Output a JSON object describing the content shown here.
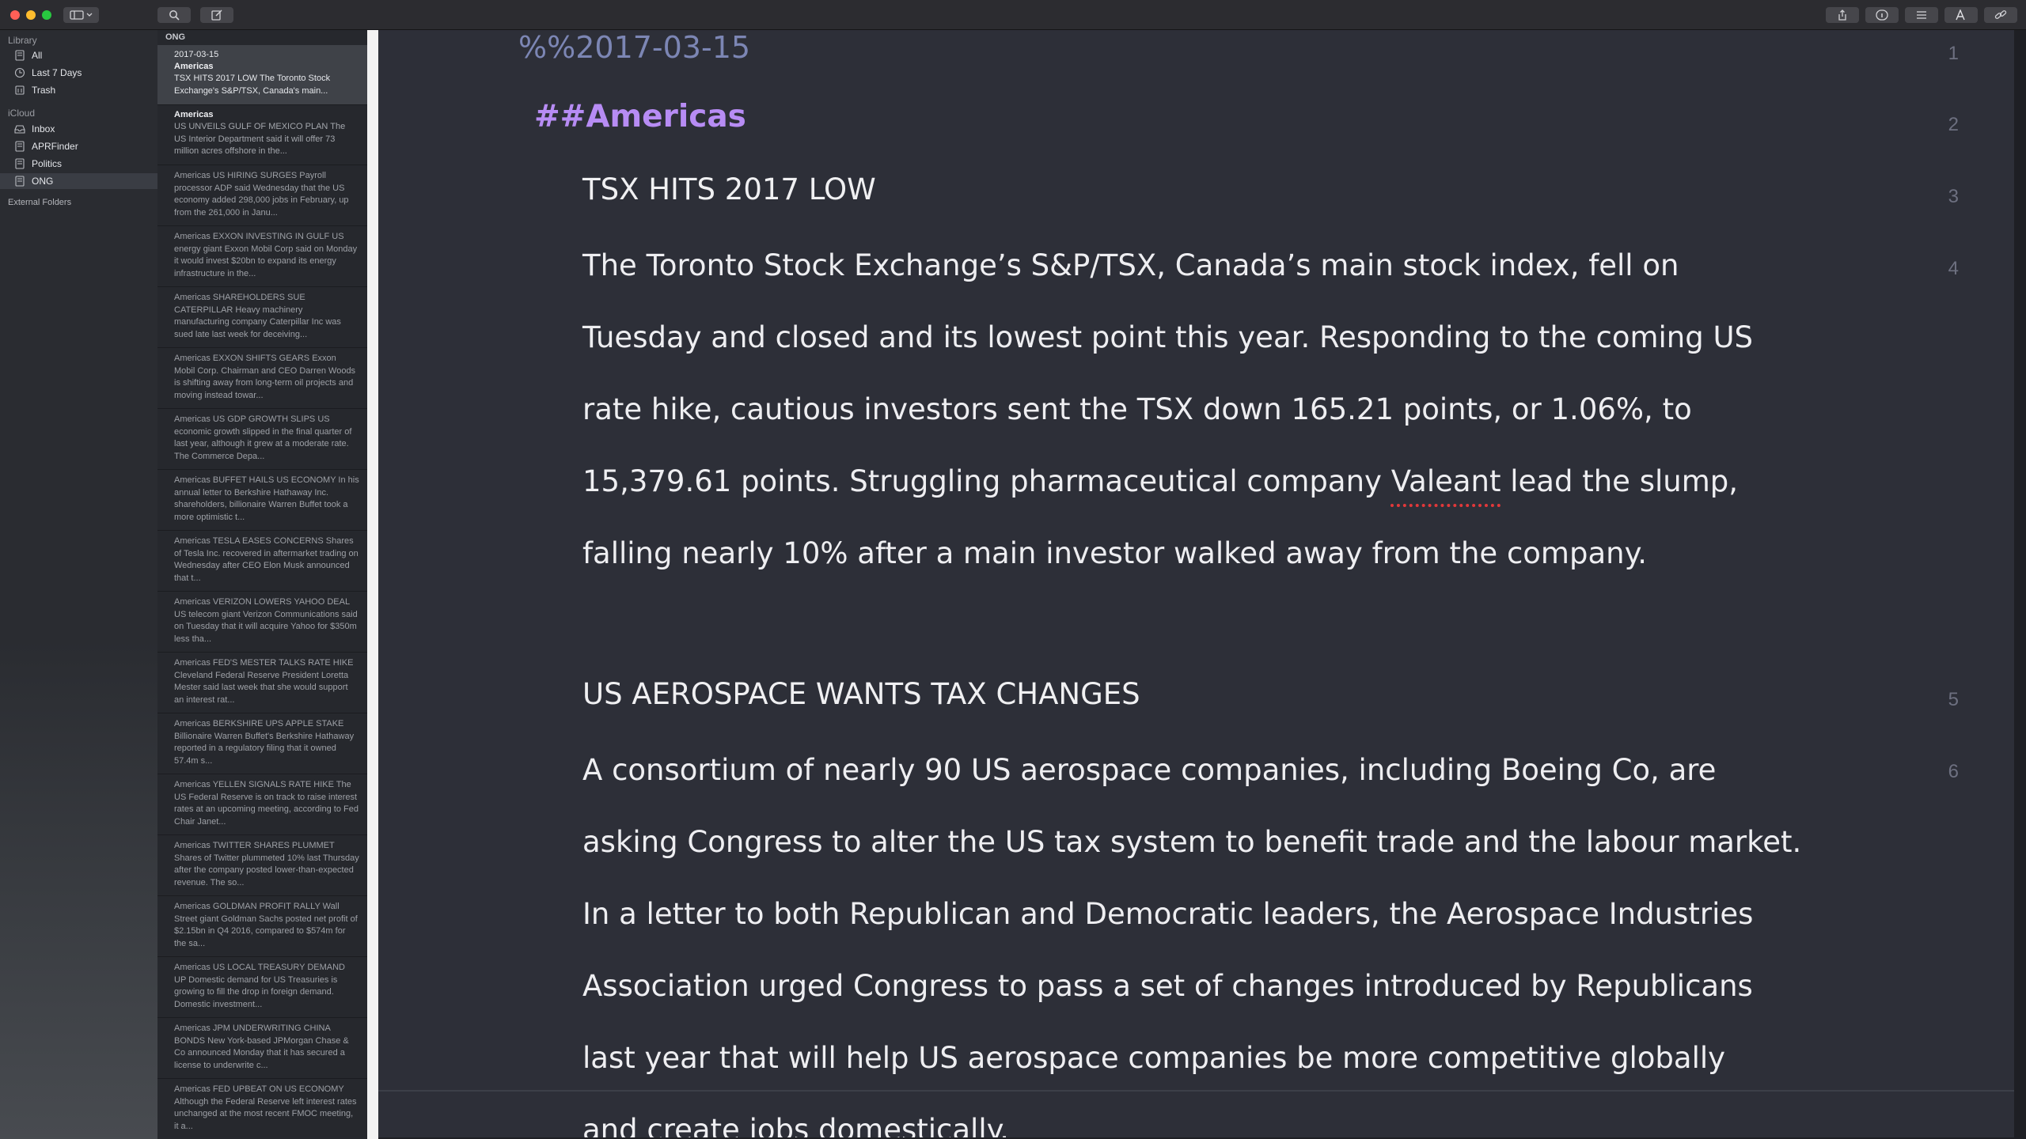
{
  "toolbar": {
    "icons": [
      "sidebar-toggle-icon",
      "search-icon",
      "compose-icon",
      "share-icon",
      "info-icon",
      "list-icon",
      "font-icon",
      "link-icon"
    ]
  },
  "sidebar": {
    "library_label": "Library",
    "library_items": [
      {
        "label": "All",
        "icon": "notes-icon"
      },
      {
        "label": "Last 7 Days",
        "icon": "clock-icon"
      },
      {
        "label": "Trash",
        "icon": "trash-icon"
      }
    ],
    "icloud_label": "iCloud",
    "icloud_items": [
      {
        "label": "Inbox",
        "icon": "inbox-icon"
      },
      {
        "label": "APRFinder",
        "icon": "folder-icon"
      },
      {
        "label": "Politics",
        "icon": "folder-icon"
      },
      {
        "label": "ONG",
        "icon": "folder-icon"
      }
    ],
    "external_label": "External Folders"
  },
  "notelist": {
    "header": "ONG",
    "notes": [
      {
        "date": "2017-03-15",
        "title": "Americas",
        "body": "TSX HITS 2017 LOW The Toronto Stock Exchange's S&P/TSX, Canada's main..."
      },
      {
        "date": "",
        "title": "Americas",
        "body": "US UNVEILS GULF OF MEXICO PLAN The US Interior Department said it will offer 73 million acres offshore in the..."
      },
      {
        "date": "",
        "title": "",
        "body": "Americas US HIRING SURGES Payroll processor ADP said Wednesday that the US economy added 298,000 jobs in February, up from the 261,000 in Janu..."
      },
      {
        "date": "",
        "title": "",
        "body": "Americas EXXON INVESTING IN GULF US energy giant Exxon Mobil Corp said on Monday it would invest $20bn to expand its energy infrastructure in the..."
      },
      {
        "date": "",
        "title": "",
        "body": "Americas SHAREHOLDERS SUE CATERPILLAR Heavy machinery manufacturing company Caterpillar Inc was sued late last week for deceiving..."
      },
      {
        "date": "",
        "title": "",
        "body": "Americas EXXON SHIFTS GEARS Exxon Mobil Corp. Chairman and CEO Darren Woods is shifting away from long-term oil projects and moving instead towar..."
      },
      {
        "date": "",
        "title": "",
        "body": "Americas US GDP GROWTH SLIPS US economic growth slipped in the final quarter of last year, although it grew at a moderate rate. The Commerce Depa..."
      },
      {
        "date": "",
        "title": "",
        "body": "Americas BUFFET HAILS US ECONOMY In his annual letter to Berkshire Hathaway Inc. shareholders, billionaire Warren Buffet took a more optimistic t..."
      },
      {
        "date": "",
        "title": "",
        "body": "Americas TESLA EASES CONCERNS Shares of Tesla Inc. recovered in aftermarket trading on Wednesday after CEO Elon Musk announced that t..."
      },
      {
        "date": "",
        "title": "",
        "body": "Americas VERIZON LOWERS YAHOO DEAL US telecom giant Verizon Communications said on Tuesday that it will acquire Yahoo for $350m less tha..."
      },
      {
        "date": "",
        "title": "",
        "body": "Americas FED'S MESTER TALKS RATE HIKE Cleveland Federal Reserve President Loretta Mester said last week that she would support an interest rat..."
      },
      {
        "date": "",
        "title": "",
        "body": "Americas BERKSHIRE UPS APPLE STAKE Billionaire Warren Buffet's Berkshire Hathaway reported in a regulatory filing that it owned 57.4m s..."
      },
      {
        "date": "",
        "title": "",
        "body": "Americas YELLEN SIGNALS RATE HIKE The US Federal Reserve is on track to raise interest rates at an upcoming meeting, according to Fed Chair Janet..."
      },
      {
        "date": "",
        "title": "",
        "body": "Americas TWITTER SHARES PLUMMET Shares of Twitter plummeted 10% last Thursday after the company posted lower-than-expected revenue. The so..."
      },
      {
        "date": "",
        "title": "",
        "body": "Americas GOLDMAN PROFIT RALLY Wall Street giant Goldman Sachs posted net profit of $2.15bn in Q4 2016, compared to $574m for the sa..."
      },
      {
        "date": "",
        "title": "",
        "body": "Americas US LOCAL TREASURY DEMAND UP Domestic demand for US Treasuries is growing to fill the drop in foreign demand. Domestic investment..."
      },
      {
        "date": "",
        "title": "",
        "body": "Americas JPM UNDERWRITING CHINA BONDS New York-based JPMorgan Chase & Co announced Monday that it has secured a license to underwrite c..."
      },
      {
        "date": "",
        "title": "",
        "body": "Americas FED UPBEAT ON US ECONOMY Although the Federal Reserve left interest rates unchanged at the most recent FMOC meeting, it a..."
      }
    ]
  },
  "editor": {
    "line1": "%%2017-03-15",
    "line2": "##Americas",
    "line3": "TSX HITS 2017 LOW",
    "para1": [
      "The Toronto Stock Exchange’s S&P/TSX, Canada’s main stock index, fell on",
      "Tuesday and closed and its lowest point this year.  Responding to the coming US",
      "rate hike, cautious investors sent the TSX down 165.21 points, or 1.06%, to",
      "15,379.61 points. Struggling pharmaceutical company ",
      "Valeant",
      " lead the slump,",
      "falling nearly 10% after a main investor walked away from the company."
    ],
    "line5": "US AEROSPACE WANTS TAX CHANGES",
    "para2": [
      "A consortium of nearly 90 US aerospace companies, including Boeing Co, are",
      "asking Congress to alter the US tax system to benefit trade and the labour market.",
      "In a letter to both Republican and Democratic leaders, the Aerospace Industries",
      "Association urged Congress to pass a set of changes introduced by Republicans",
      "last year that will help US aerospace companies be more competitive globally",
      "and create jobs domestically."
    ],
    "line_numbers": [
      "1",
      "2",
      "3",
      "4",
      "5",
      "6"
    ]
  }
}
